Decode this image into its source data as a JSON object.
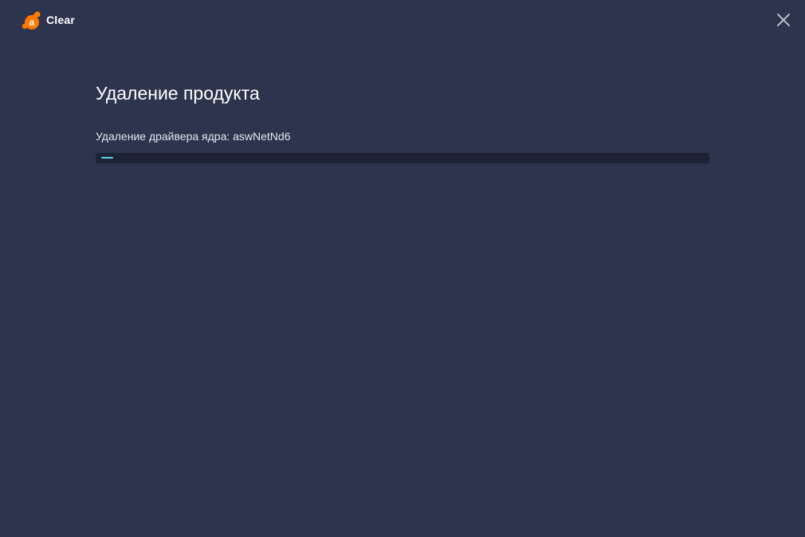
{
  "app": {
    "name": "Clear",
    "logo_icon": "avast-logo-icon",
    "brand_color": "#ff7800"
  },
  "window_controls": {
    "close_icon": "close-icon"
  },
  "main": {
    "title": "Удаление продукта",
    "status": "Удаление драйвера ядра: aswNetNd6",
    "progress_percent": 2
  },
  "colors": {
    "background": "#2d344d",
    "progress_track": "#1d2234",
    "progress_fill": "#5fd4f0"
  }
}
